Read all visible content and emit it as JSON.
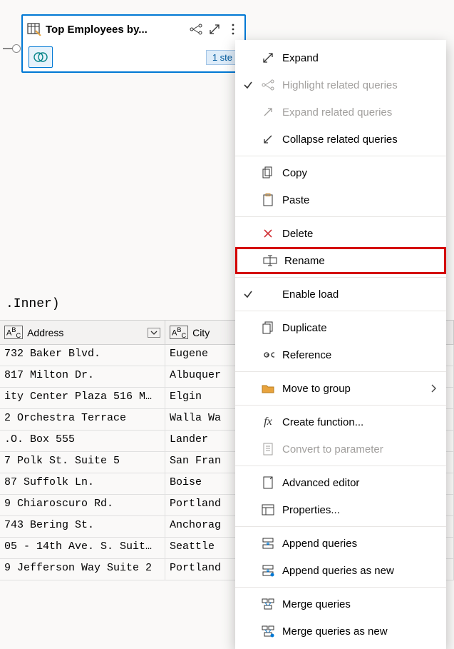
{
  "node": {
    "title": "Top Employees by...",
    "steps_label": "1 ste"
  },
  "menu": {
    "items": [
      {
        "label": "Expand",
        "icon": "expand-arrows-icon",
        "checked": false,
        "disabled": false,
        "sep": false
      },
      {
        "label": "Highlight related queries",
        "icon": "related-icon",
        "checked": true,
        "disabled": true,
        "sep": false
      },
      {
        "label": "Expand related queries",
        "icon": "expand-diag-icon",
        "checked": false,
        "disabled": true,
        "sep": false
      },
      {
        "label": "Collapse related queries",
        "icon": "collapse-diag-icon",
        "checked": false,
        "disabled": false,
        "sep": true
      },
      {
        "label": "Copy",
        "icon": "copy-icon",
        "checked": false,
        "disabled": false,
        "sep": false
      },
      {
        "label": "Paste",
        "icon": "paste-icon",
        "checked": false,
        "disabled": false,
        "sep": true
      },
      {
        "label": "Delete",
        "icon": "delete-icon",
        "checked": false,
        "disabled": false,
        "sep": false
      },
      {
        "label": "Rename",
        "icon": "rename-icon",
        "checked": false,
        "disabled": false,
        "sep": true,
        "highlight": true
      },
      {
        "label": "Enable load",
        "icon": "",
        "checked": true,
        "disabled": false,
        "sep": true
      },
      {
        "label": "Duplicate",
        "icon": "duplicate-icon",
        "checked": false,
        "disabled": false,
        "sep": false
      },
      {
        "label": "Reference",
        "icon": "reference-icon",
        "checked": false,
        "disabled": false,
        "sep": true
      },
      {
        "label": "Move to group",
        "icon": "folder-icon",
        "checked": false,
        "disabled": false,
        "submenu": true,
        "sep": true
      },
      {
        "label": "Create function...",
        "icon": "fx-icon",
        "checked": false,
        "disabled": false,
        "sep": false
      },
      {
        "label": "Convert to parameter",
        "icon": "parameter-icon",
        "checked": false,
        "disabled": true,
        "sep": true
      },
      {
        "label": "Advanced editor",
        "icon": "editor-icon",
        "checked": false,
        "disabled": false,
        "sep": false
      },
      {
        "label": "Properties...",
        "icon": "properties-icon",
        "checked": false,
        "disabled": false,
        "sep": true
      },
      {
        "label": "Append queries",
        "icon": "append-icon",
        "checked": false,
        "disabled": false,
        "sep": false
      },
      {
        "label": "Append queries as new",
        "icon": "append-new-icon",
        "checked": false,
        "disabled": false,
        "sep": true
      },
      {
        "label": "Merge queries",
        "icon": "merge-icon",
        "checked": false,
        "disabled": false,
        "sep": false
      },
      {
        "label": "Merge queries as new",
        "icon": "merge-new-icon",
        "checked": false,
        "disabled": false,
        "sep": false
      }
    ]
  },
  "formula": ".Inner)",
  "table": {
    "headers": {
      "address": "Address",
      "city": "City"
    },
    "rows": [
      {
        "address": "732 Baker Blvd.",
        "city": "Eugene"
      },
      {
        "address": "817 Milton Dr.",
        "city": "Albuquer"
      },
      {
        "address": "ity Center Plaza 516 M…",
        "city": "Elgin"
      },
      {
        "address": "2 Orchestra Terrace",
        "city": "Walla Wa"
      },
      {
        "address": ".O. Box 555",
        "city": "Lander"
      },
      {
        "address": "7 Polk St. Suite 5",
        "city": "San Fran"
      },
      {
        "address": "87 Suffolk Ln.",
        "city": "Boise"
      },
      {
        "address": "9 Chiaroscuro Rd.",
        "city": "Portland"
      },
      {
        "address": "743 Bering St.",
        "city": "Anchorag"
      },
      {
        "address": "05 - 14th Ave. S. Suit…",
        "city": "Seattle"
      },
      {
        "address": "9 Jefferson Way Suite 2",
        "city": "Portland"
      }
    ]
  }
}
